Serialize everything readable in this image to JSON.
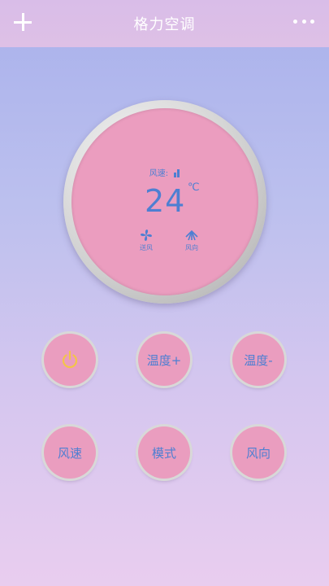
{
  "header": {
    "title": "格力空调",
    "add_icon": "plus-icon",
    "more_icon": "more-horizontal-icon"
  },
  "dial": {
    "fan_speed_label": "风速:",
    "temperature": "24",
    "unit": "℃",
    "modes": [
      {
        "label": "送风",
        "icon": "fan-icon"
      },
      {
        "label": "风向",
        "icon": "swing-direction-icon"
      }
    ]
  },
  "controls": [
    {
      "label": "",
      "icon": "power-icon"
    },
    {
      "label": "温度+"
    },
    {
      "label": "温度-"
    },
    {
      "label": "风速"
    },
    {
      "label": "模式"
    },
    {
      "label": "风向"
    }
  ],
  "colors": {
    "accent_text": "#4e7fd2",
    "button_pink": "#ea9dbf",
    "power_icon": "#f3c44a"
  }
}
